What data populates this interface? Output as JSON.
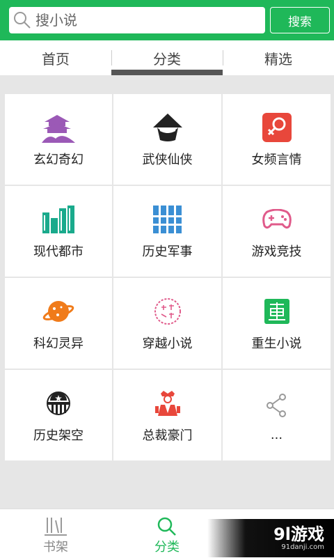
{
  "search": {
    "placeholder": "搜小说",
    "button_label": "搜索"
  },
  "tabs": [
    {
      "label": "首页"
    },
    {
      "label": "分类",
      "active": true
    },
    {
      "label": "精选"
    }
  ],
  "categories": [
    {
      "label": "玄幻奇幻",
      "icon": "pagoda-icon"
    },
    {
      "label": "武侠仙侠",
      "icon": "swordsman-hat-icon"
    },
    {
      "label": "女频言情",
      "icon": "female-symbol-icon"
    },
    {
      "label": "现代都市",
      "icon": "city-buildings-icon"
    },
    {
      "label": "历史军事",
      "icon": "scroll-books-icon"
    },
    {
      "label": "游戏竞技",
      "icon": "gamepad-icon"
    },
    {
      "label": "科幻灵异",
      "icon": "planet-icon"
    },
    {
      "label": "穿越小说",
      "icon": "seal-stamp-icon"
    },
    {
      "label": "重生小说",
      "icon": "rebirth-badge-icon"
    },
    {
      "label": "历史架空",
      "icon": "history-emblem-icon"
    },
    {
      "label": "总裁豪门",
      "icon": "ceo-figure-icon"
    },
    {
      "label": "...",
      "icon": "share-nodes-icon"
    }
  ],
  "bottom_nav": [
    {
      "label": "书架",
      "icon": "bookshelf-icon"
    },
    {
      "label": "分类",
      "icon": "search-icon",
      "active": true
    },
    {
      "label": "",
      "icon": "more-icon"
    }
  ],
  "watermark": {
    "main": "9l游戏",
    "sub": "91danji.com"
  },
  "colors": {
    "brand_green": "#1fb859",
    "purple": "#9b59b6",
    "teal": "#1aaa8c",
    "orange": "#f07b1a",
    "red": "#e8473b",
    "pink": "#e05a8a"
  }
}
